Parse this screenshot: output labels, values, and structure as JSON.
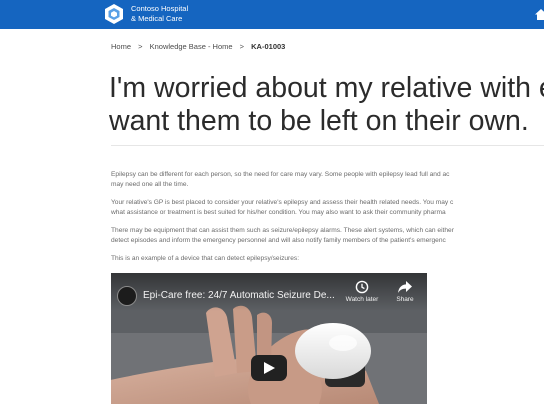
{
  "header": {
    "brand_line1": "Contoso Hospital",
    "brand_line2": "& Medical Care",
    "logo_icon": "hexagon-logo-icon",
    "home_icon": "home-icon",
    "bar_color": "#1565c0"
  },
  "breadcrumb": {
    "home": "Home",
    "knowledge_base": "Knowledge Base - Home",
    "separator": ">",
    "current": "KA-01003"
  },
  "article": {
    "title_line1": "I'm worried about my relative with epilep",
    "title_line2": "want them to be left on their own.",
    "paragraphs": [
      {
        "line1": "Epilepsy can be different for each person, so the need for care may vary. Some people with epilepsy lead full and ac",
        "line2": "may need one all the time."
      },
      {
        "line1": "Your relative's GP is best placed to consider your relative's epilepsy and assess their health related needs. You may c",
        "line2": "what assistance or treatment is best suited for his/her condition. You may also want to ask their community pharma"
      },
      {
        "line1": "There may be equipment that can assist them such as seizure/epilepsy alarms. These alert systems, which can either",
        "line2": "detect episodes and inform the emergency personnel and will also notify family members of the patient's emergenc"
      },
      {
        "line1": "This is an example of a device that can detect epilepsy/seizures:"
      }
    ]
  },
  "video": {
    "title": "Epi-Care free: 24/7 Automatic Seizure De...",
    "watch_later_label": "Watch later",
    "share_label": "Share",
    "watch_later_icon": "clock-icon",
    "share_icon": "share-arrow-icon",
    "play_icon": "play-icon"
  }
}
